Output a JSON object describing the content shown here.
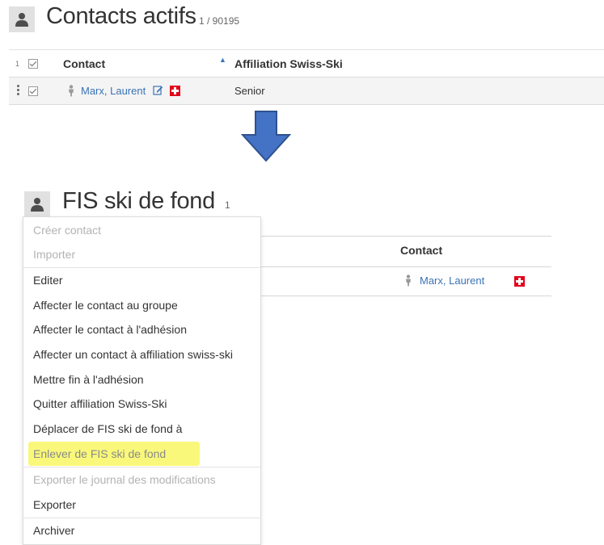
{
  "top_panel": {
    "title": "Contacts actifs",
    "count": "1 / 90195",
    "header": {
      "selected_count": "1",
      "col_contact": "Contact",
      "col_affiliation": "Affiliation Swiss-Ski",
      "sort_indicator": "▲"
    },
    "row": {
      "contact_name": "Marx, Laurent",
      "affiliation": "Senior"
    },
    "icons": [
      "person-icon",
      "edit-icon",
      "swiss-flag-icon",
      "kebab-menu-icon"
    ]
  },
  "arrow": {
    "color": "#4472c4",
    "icon": "arrow-down-icon"
  },
  "bottom_panel": {
    "title": "FIS ski de fond",
    "count": "1",
    "background_table": {
      "col_contact": "Contact",
      "row_contact_name": "Marx, Laurent"
    },
    "menu": {
      "items": [
        {
          "label": "Créer contact",
          "disabled": true
        },
        {
          "label": "Importer",
          "disabled": true
        },
        {
          "label": "Editer",
          "disabled": false
        },
        {
          "label": "Affecter le contact au groupe",
          "disabled": false
        },
        {
          "label": "Affecter le contact à l'adhésion",
          "disabled": false
        },
        {
          "label": "Affecter un contact à affiliation swiss-ski",
          "disabled": false
        },
        {
          "label": "Mettre fin à l'adhésion",
          "disabled": false
        },
        {
          "label": "Quitter affiliation Swiss-Ski",
          "disabled": false
        },
        {
          "label": "Déplacer de FIS ski de fond à",
          "disabled": false
        },
        {
          "label": "Enlever de FIS ski de fond",
          "disabled": false,
          "highlighted": true
        },
        {
          "label": "Exporter le journal des modifications",
          "disabled": true
        },
        {
          "label": "Exporter",
          "disabled": false
        },
        {
          "label": "Archiver",
          "disabled": false
        }
      ]
    }
  },
  "colors": {
    "link": "#3a73b5",
    "highlight": "#f9f87a",
    "swiss_red": "#e2001a",
    "disabled_text": "#b3b3b3"
  }
}
